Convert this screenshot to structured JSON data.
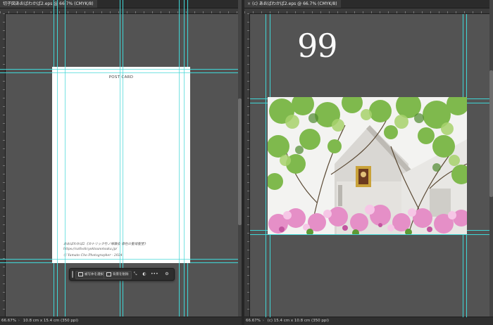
{
  "left_document": {
    "tab_title": "切子図あおばわかば2.eps @ 66.7% (CMYK/8)",
    "page": {
      "postcard_label": "POST CARD",
      "address_lines": [
        "あおばわかば2《カトリック竹ノ塚教会 御在の聖母聖堂》",
        "https://catholicyoktsunotsuka.jp/",
        "Ⓒ Yamato Cho Photographer - 2024"
      ]
    },
    "context_bar": {
      "select_subject_label": "被写体を選択",
      "remove_background_label": "背景を削除",
      "icons": [
        "transform-icon",
        "mask-icon",
        "more-icon",
        "settings-icon"
      ],
      "more_label": "•••"
    },
    "status": {
      "zoom": "66.67%",
      "dimensions": "10.8 cm x 15.4 cm (350 ppi)"
    }
  },
  "right_document": {
    "tab_title": "(c) あおばわかば2.eps @ 66.7% (CMYK/8)",
    "close_glyph": "×",
    "page_number_text": "99",
    "photo_icon": "church-azalea-photo",
    "status": {
      "zoom": "66.67%",
      "dimensions": "(c) 15.4 cm x 10.8 cm (350 ppi)"
    }
  },
  "colors": {
    "canvas": "#535353",
    "guide": "#3fd6d6",
    "panel_dark": "#2e2e2e"
  }
}
